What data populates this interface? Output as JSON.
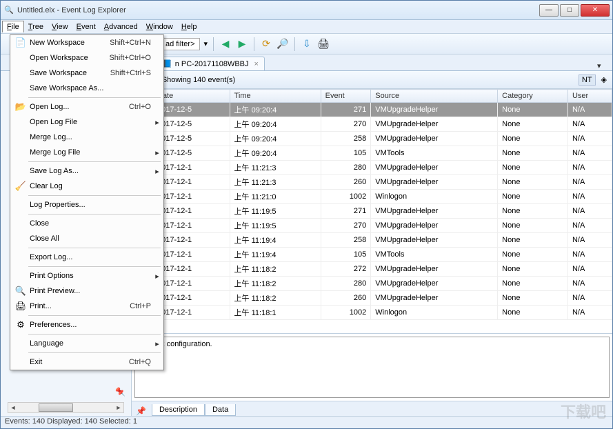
{
  "window": {
    "title": "Untitled.elx - Event Log Explorer"
  },
  "menubar": [
    "File",
    "Tree",
    "View",
    "Event",
    "Advanced",
    "Window",
    "Help"
  ],
  "filemenu": [
    {
      "icon": "📄",
      "label": "New Workspace",
      "shortcut": "Shift+Ctrl+N"
    },
    {
      "icon": "",
      "label": "Open Workspace",
      "shortcut": "Shift+Ctrl+O"
    },
    {
      "icon": "",
      "label": "Save Workspace",
      "shortcut": "Shift+Ctrl+S"
    },
    {
      "icon": "",
      "label": "Save Workspace As...",
      "shortcut": ""
    },
    {
      "sep": true
    },
    {
      "icon": "📂",
      "label": "Open Log...",
      "shortcut": "Ctrl+O"
    },
    {
      "icon": "",
      "label": "Open Log File",
      "shortcut": "",
      "sub": true
    },
    {
      "icon": "",
      "label": "Merge Log...",
      "shortcut": ""
    },
    {
      "icon": "",
      "label": "Merge Log File",
      "shortcut": "",
      "sub": true
    },
    {
      "sep": true
    },
    {
      "icon": "",
      "label": "Save Log As...",
      "shortcut": "",
      "sub": true
    },
    {
      "icon": "🧹",
      "label": "Clear Log",
      "shortcut": ""
    },
    {
      "sep": true
    },
    {
      "icon": "",
      "label": "Log Properties...",
      "shortcut": ""
    },
    {
      "sep": true
    },
    {
      "icon": "",
      "label": "Close",
      "shortcut": ""
    },
    {
      "icon": "",
      "label": "Close All",
      "shortcut": ""
    },
    {
      "sep": true
    },
    {
      "icon": "",
      "label": "Export Log...",
      "shortcut": ""
    },
    {
      "sep": true
    },
    {
      "icon": "",
      "label": "Print Options",
      "shortcut": "",
      "sub": true
    },
    {
      "icon": "🔍",
      "label": "Print Preview...",
      "shortcut": ""
    },
    {
      "icon": "🖨",
      "label": "Print...",
      "shortcut": "Ctrl+P"
    },
    {
      "sep": true
    },
    {
      "icon": "⚙",
      "label": "Preferences...",
      "shortcut": ""
    },
    {
      "sep": true
    },
    {
      "icon": "",
      "label": "Language",
      "shortcut": "",
      "sub": true
    },
    {
      "sep": true
    },
    {
      "icon": "",
      "label": "Exit",
      "shortcut": "Ctrl+Q"
    }
  ],
  "toolbar": {
    "filter_label": "ad filter>"
  },
  "tab": {
    "label": "n PC-20171108WBBJ"
  },
  "inforow": {
    "showing": "Showing 140 event(s)",
    "badge": "NT"
  },
  "columns": [
    "",
    "Date",
    "Time",
    "Event",
    "Source",
    "Category",
    "User"
  ],
  "rows": [
    {
      "t": "n",
      "date": "2017-12-5",
      "time": "上午 09:20:4",
      "event": 271,
      "source": "VMUpgradeHelper",
      "cat": "None",
      "user": "N/A",
      "sel": true
    },
    {
      "t": "n",
      "date": "2017-12-5",
      "time": "上午 09:20:4",
      "event": 270,
      "source": "VMUpgradeHelper",
      "cat": "None",
      "user": "N/A"
    },
    {
      "t": "n",
      "date": "2017-12-5",
      "time": "上午 09:20:4",
      "event": 258,
      "source": "VMUpgradeHelper",
      "cat": "None",
      "user": "N/A"
    },
    {
      "t": "n",
      "date": "2017-12-5",
      "time": "上午 09:20:4",
      "event": 105,
      "source": "VMTools",
      "cat": "None",
      "user": "N/A"
    },
    {
      "t": "n",
      "date": "2017-12-1",
      "time": "上午 11:21:3",
      "event": 280,
      "source": "VMUpgradeHelper",
      "cat": "None",
      "user": "N/A"
    },
    {
      "t": "n",
      "date": "2017-12-1",
      "time": "上午 11:21:3",
      "event": 260,
      "source": "VMUpgradeHelper",
      "cat": "None",
      "user": "N/A"
    },
    {
      "t": "n",
      "date": "2017-12-1",
      "time": "上午 11:21:0",
      "event": 1002,
      "source": "Winlogon",
      "cat": "None",
      "user": "N/A"
    },
    {
      "t": "n",
      "date": "2017-12-1",
      "time": "上午 11:19:5",
      "event": 271,
      "source": "VMUpgradeHelper",
      "cat": "None",
      "user": "N/A"
    },
    {
      "t": "n",
      "date": "2017-12-1",
      "time": "上午 11:19:5",
      "event": 270,
      "source": "VMUpgradeHelper",
      "cat": "None",
      "user": "N/A"
    },
    {
      "t": "n",
      "date": "2017-12-1",
      "time": "上午 11:19:4",
      "event": 258,
      "source": "VMUpgradeHelper",
      "cat": "None",
      "user": "N/A"
    },
    {
      "t": "n",
      "date": "2017-12-1",
      "time": "上午 11:19:4",
      "event": 105,
      "source": "VMTools",
      "cat": "None",
      "user": "N/A"
    },
    {
      "t": "n",
      "date": "2017-12-1",
      "time": "上午 11:18:2",
      "event": 272,
      "source": "VMUpgradeHelper",
      "cat": "None",
      "user": "N/A"
    },
    {
      "t": "n",
      "date": "2017-12-1",
      "time": "上午 11:18:2",
      "event": 280,
      "source": "VMUpgradeHelper",
      "cat": "None",
      "user": "N/A"
    },
    {
      "t": "n",
      "date": "2017-12-1",
      "time": "上午 11:18:2",
      "event": 260,
      "source": "VMUpgradeHelper",
      "cat": "None",
      "user": "N/A"
    },
    {
      "t": "n",
      "date": "2017-12-1",
      "time": "上午 11:18:1",
      "event": 1002,
      "source": "Winlogon",
      "cat": "None",
      "user": "N/A"
    }
  ],
  "description": {
    "text": "network configuration."
  },
  "desc_tabs": [
    "Description",
    "Data"
  ],
  "status": "Events: 140   Displayed: 140   Selected: 1",
  "watermark": "下载吧"
}
